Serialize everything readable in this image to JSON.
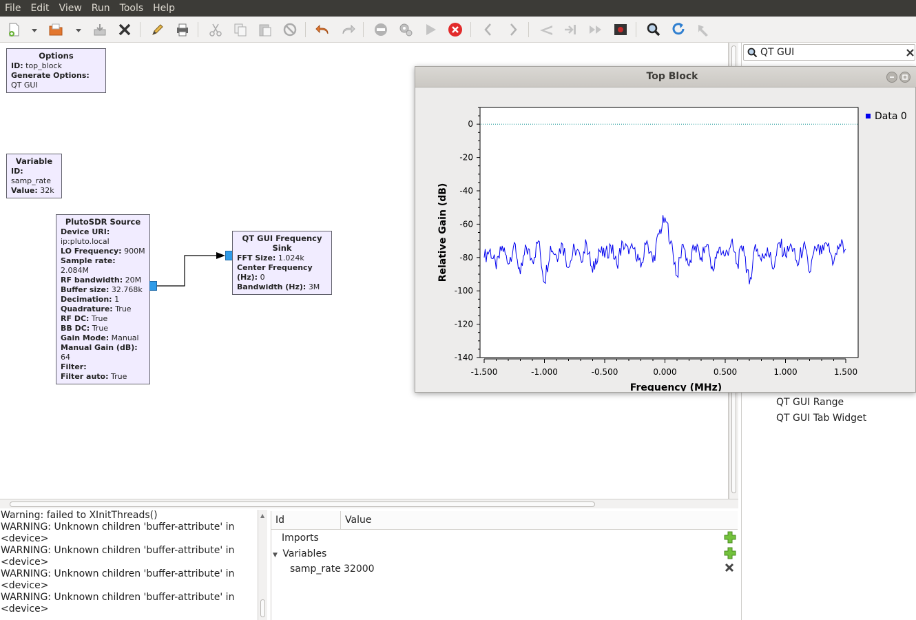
{
  "menubar": {
    "items": [
      "File",
      "Edit",
      "View",
      "Run",
      "Tools",
      "Help"
    ]
  },
  "toolbar": {
    "buttons": [
      "new-icon",
      "open-icon",
      "save-icon",
      "close-icon",
      "edit-icon",
      "print-icon",
      "cut-icon",
      "copy-icon",
      "paste-icon",
      "disable-icon",
      "undo-icon",
      "redo-icon",
      "stop-sign-icon",
      "gears-icon",
      "play-icon",
      "kill-icon",
      "back-icon",
      "forward-icon",
      "rotate-left-icon",
      "rotate-right-icon",
      "fast-forward-icon",
      "screen-capture-icon",
      "find-icon",
      "reload-icon",
      "arrow-icon"
    ]
  },
  "blocks": {
    "options": {
      "title": "Options",
      "rows": [
        [
          "ID:",
          "top_block"
        ],
        [
          "Generate Options:",
          "QT GUI"
        ]
      ]
    },
    "variable": {
      "title": "Variable",
      "rows": [
        [
          "ID:",
          "samp_rate"
        ],
        [
          "Value:",
          "32k"
        ]
      ]
    },
    "pluto": {
      "title": "PlutoSDR Source",
      "rows": [
        [
          "Device URI:",
          "ip:pluto.local"
        ],
        [
          "LO Frequency:",
          "900M"
        ],
        [
          "Sample rate:",
          "2.084M"
        ],
        [
          "RF bandwidth:",
          "20M"
        ],
        [
          "Buffer size:",
          "32.768k"
        ],
        [
          "Decimation:",
          "1"
        ],
        [
          "Quadrature:",
          "True"
        ],
        [
          "RF DC:",
          "True"
        ],
        [
          "BB DC:",
          "True"
        ],
        [
          "Gain Mode:",
          "Manual"
        ],
        [
          "Manual Gain (dB):",
          "64"
        ],
        [
          "Filter:",
          ""
        ],
        [
          "Filter auto:",
          "True"
        ]
      ]
    },
    "freqsink": {
      "title": "QT GUI Frequency Sink",
      "rows": [
        [
          "FFT Size:",
          "1.024k"
        ],
        [
          "Center Frequency (Hz):",
          "0"
        ],
        [
          "Bandwidth (Hz):",
          "3M"
        ]
      ]
    }
  },
  "console": {
    "lines": [
      "Warning: failed to XInitThreads()",
      "WARNING: Unknown children 'buffer-attribute' in",
      "<device>",
      "WARNING: Unknown children 'buffer-attribute' in",
      "<device>",
      "WARNING: Unknown children 'buffer-attribute' in",
      "<device>",
      "WARNING: Unknown children 'buffer-attribute' in",
      "<device>"
    ]
  },
  "variables_panel": {
    "col_id": "Id",
    "col_value": "Value",
    "imports": "Imports",
    "variables": "Variables",
    "var_name": "samp_rate",
    "var_value": "32000"
  },
  "right_panel": {
    "search_value": "QT GUI",
    "items": [
      "QT GUI Range",
      "QT GUI Tab Widget"
    ]
  },
  "qt_window": {
    "title": "Top Block",
    "legend": "Data 0",
    "legend_color": "#0000ee"
  },
  "chart_data": {
    "type": "line",
    "title": "",
    "xlabel": "Frequency (MHz)",
    "ylabel": "Relative Gain (dB)",
    "xlim": [
      -1.5,
      1.5
    ],
    "ylim": [
      -140,
      10
    ],
    "xticks": [
      "-1.500",
      "-1.000",
      "-0.500",
      "0.000",
      "0.500",
      "1.000",
      "1.500"
    ],
    "yticks": [
      "0",
      "-20",
      "-40",
      "-60",
      "-80",
      "-100",
      "-120",
      "-140"
    ],
    "reference_line": 0,
    "series": [
      {
        "name": "Data 0",
        "color": "#0000ee",
        "x": [
          -1.5,
          -1.45,
          -1.4,
          -1.35,
          -1.3,
          -1.25,
          -1.2,
          -1.15,
          -1.1,
          -1.05,
          -1.0,
          -0.95,
          -0.9,
          -0.85,
          -0.8,
          -0.75,
          -0.7,
          -0.65,
          -0.6,
          -0.55,
          -0.5,
          -0.45,
          -0.4,
          -0.35,
          -0.3,
          -0.25,
          -0.2,
          -0.15,
          -0.1,
          -0.05,
          0.0,
          0.05,
          0.1,
          0.15,
          0.2,
          0.25,
          0.3,
          0.35,
          0.4,
          0.45,
          0.5,
          0.55,
          0.6,
          0.65,
          0.7,
          0.75,
          0.8,
          0.85,
          0.9,
          0.95,
          1.0,
          1.05,
          1.1,
          1.15,
          1.2,
          1.25,
          1.3,
          1.35,
          1.4,
          1.45,
          1.5
        ],
        "values": [
          -80,
          -75,
          -87,
          -73,
          -84,
          -71,
          -90,
          -74,
          -82,
          -70,
          -95,
          -73,
          -79,
          -72,
          -86,
          -74,
          -81,
          -72,
          -89,
          -75,
          -80,
          -73,
          -84,
          -71,
          -78,
          -74,
          -86,
          -70,
          -83,
          -66,
          -56,
          -70,
          -91,
          -72,
          -85,
          -73,
          -80,
          -72,
          -88,
          -74,
          -79,
          -71,
          -84,
          -73,
          -96,
          -72,
          -82,
          -74,
          -87,
          -71,
          -79,
          -73,
          -85,
          -72,
          -89,
          -74,
          -78,
          -73,
          -83,
          -72,
          -75
        ]
      }
    ]
  }
}
